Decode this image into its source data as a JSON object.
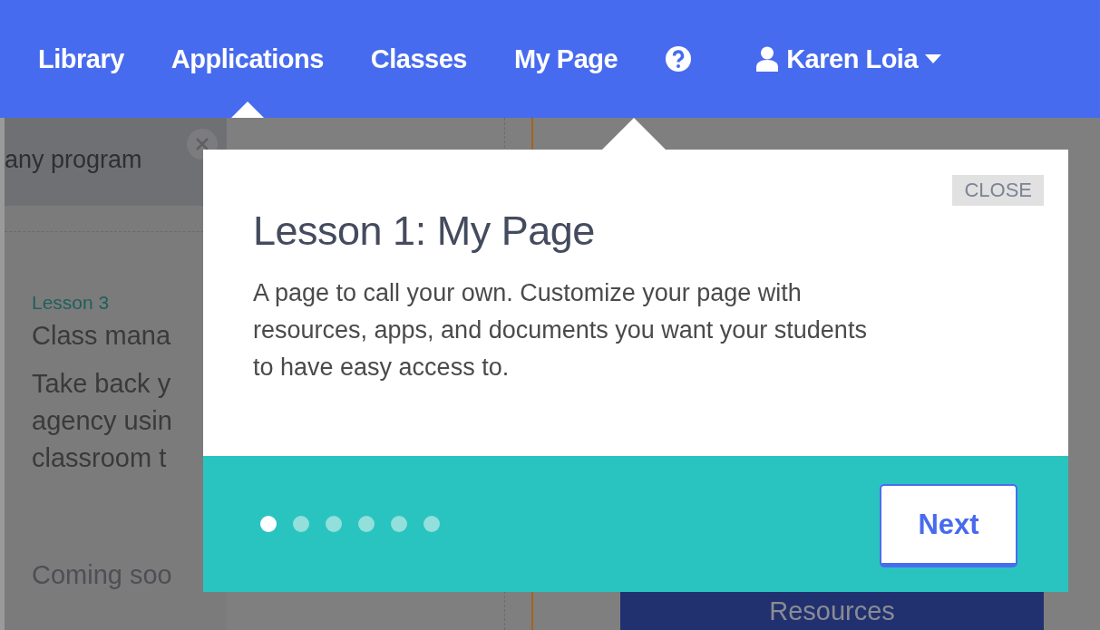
{
  "nav": {
    "items": [
      {
        "label": "Library",
        "selected": false
      },
      {
        "label": "Applications",
        "selected": true
      },
      {
        "label": "Classes",
        "selected": false
      },
      {
        "label": "My Page",
        "selected": false
      }
    ],
    "user": {
      "name": "Karen Loia"
    }
  },
  "background": {
    "banner": "any program",
    "lesson_label": "Lesson 3",
    "lesson_title": "Class mana",
    "description_lines": [
      "Take back y",
      "agency usin",
      "classroom t"
    ],
    "status": "Coming soo",
    "resources_button": "Resources"
  },
  "tour": {
    "close": "CLOSE",
    "title": "Lesson 1: My Page",
    "body": "A page to call your own. Customize your page with resources, apps, and documents you want your students to have easy access to.",
    "steps": [
      {
        "selected": true
      },
      {
        "selected": false
      },
      {
        "selected": false
      },
      {
        "selected": false
      },
      {
        "selected": false
      },
      {
        "selected": false
      }
    ],
    "next": "Next"
  }
}
